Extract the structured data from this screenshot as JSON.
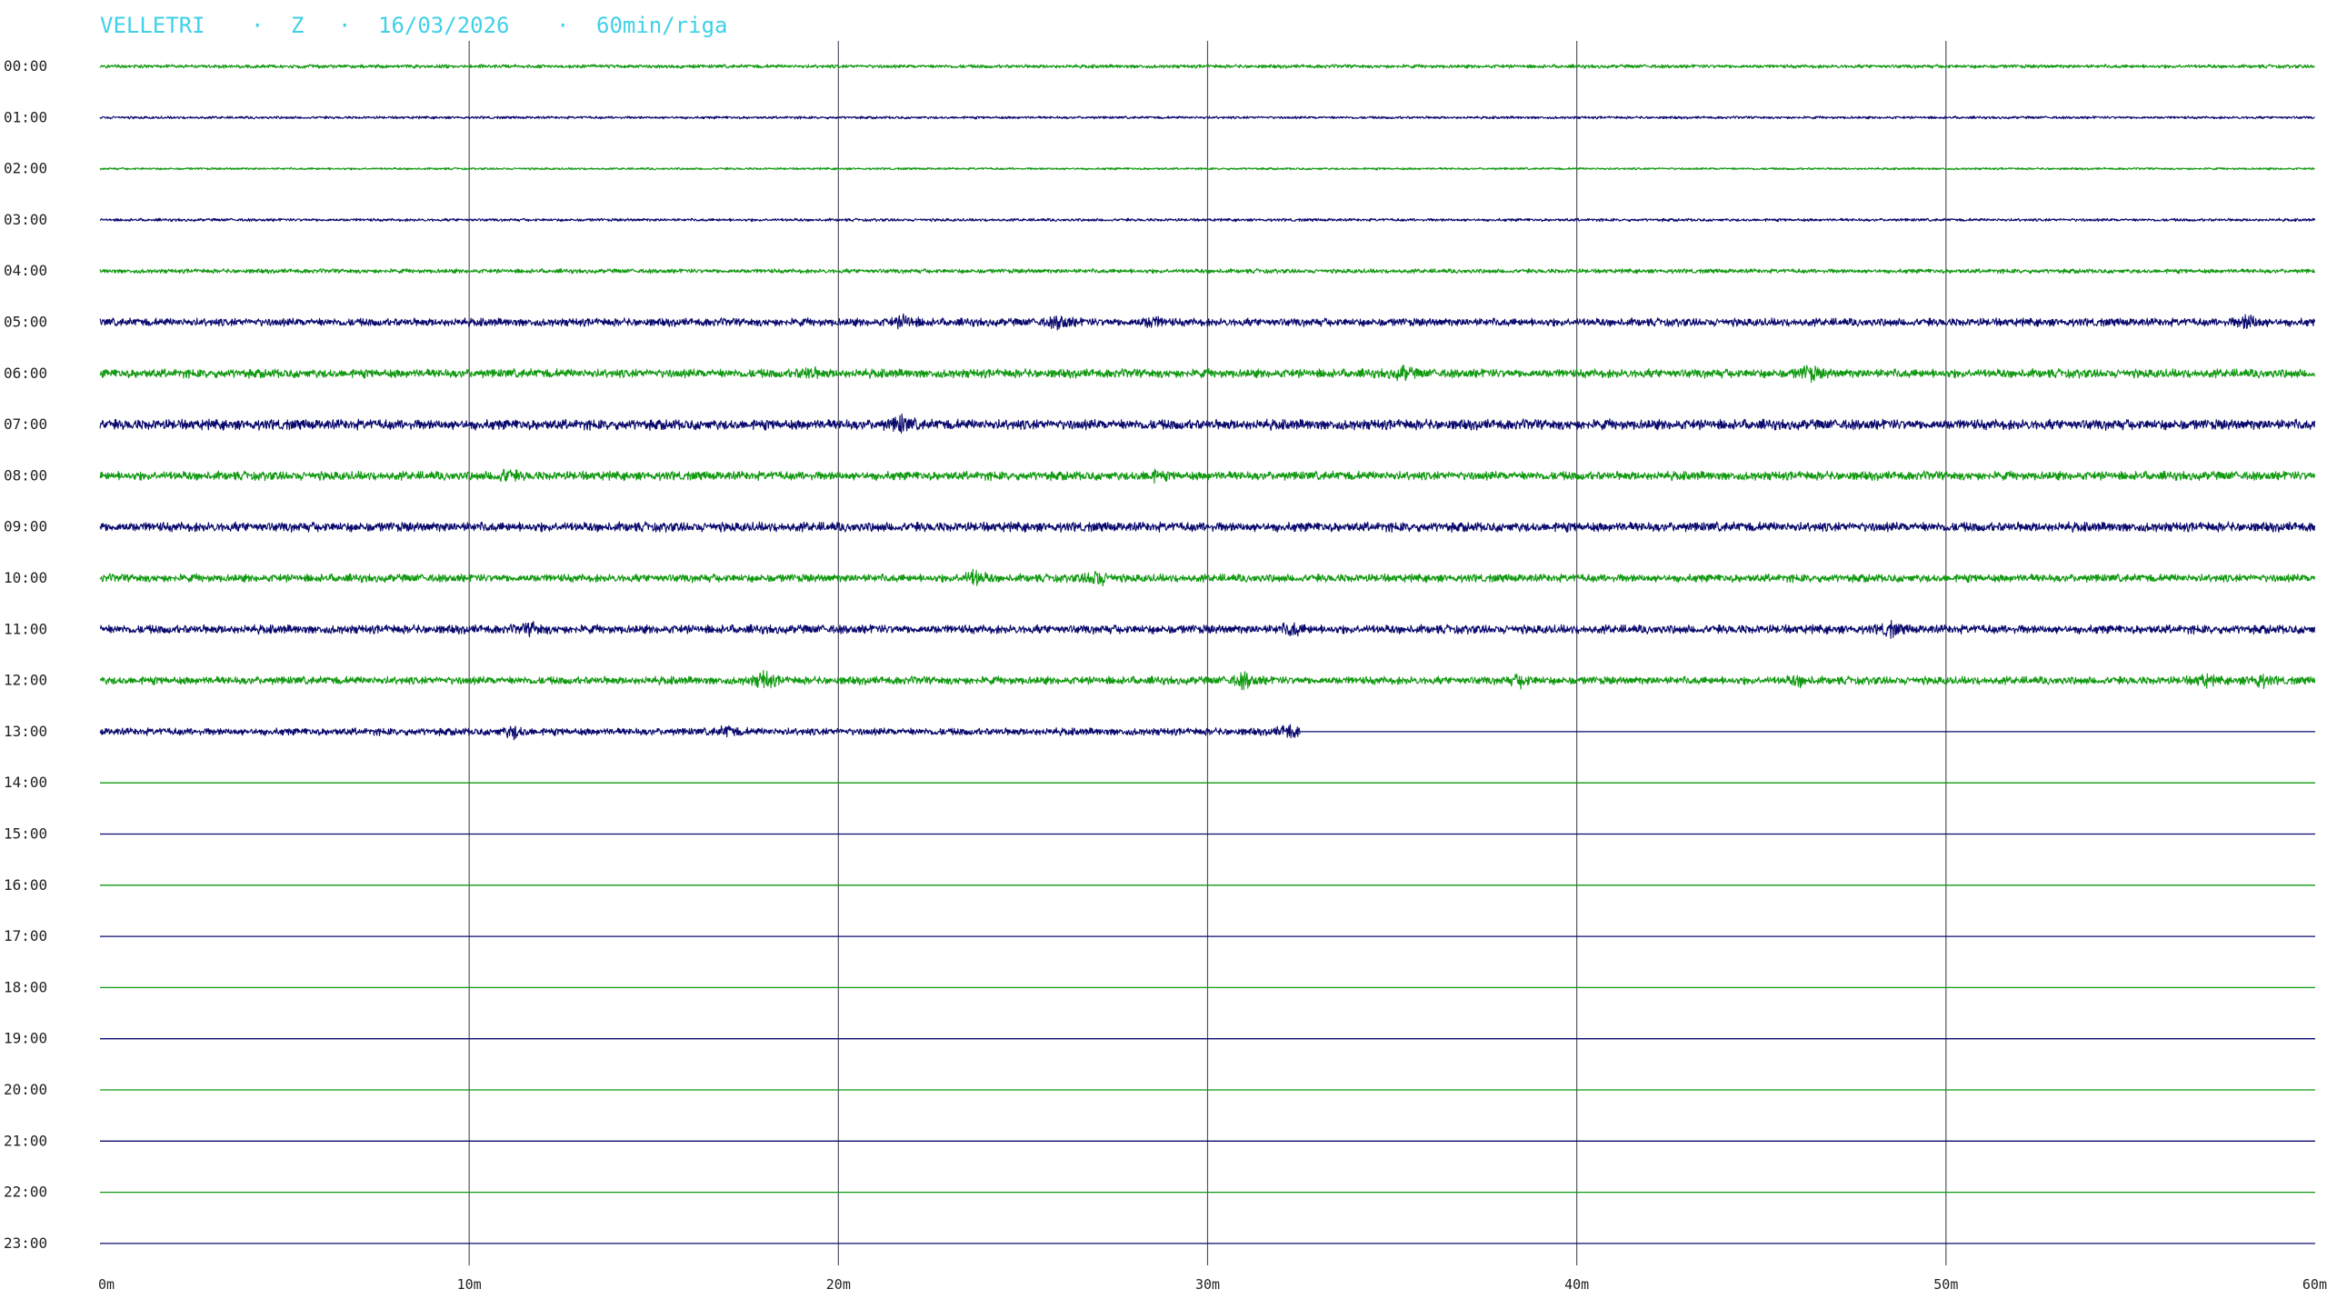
{
  "header": {
    "station": "VELLETRI",
    "component": "Z",
    "date": "16/03/2026",
    "scale": "60min/riga",
    "separator": "·"
  },
  "chart_data": {
    "type": "helicorder",
    "rows": [
      "00:00",
      "01:00",
      "02:00",
      "03:00",
      "04:00",
      "05:00",
      "06:00",
      "07:00",
      "08:00",
      "09:00",
      "10:00",
      "11:00",
      "12:00",
      "13:00",
      "14:00",
      "15:00",
      "16:00",
      "17:00",
      "18:00",
      "19:00",
      "20:00",
      "21:00",
      "22:00",
      "23:00"
    ],
    "x_ticks": [
      "0m",
      "10m",
      "20m",
      "30m",
      "40m",
      "50m",
      "60m"
    ],
    "x_tick_values": [
      0,
      10,
      20,
      30,
      40,
      50,
      60
    ],
    "xlim": [
      0,
      60
    ],
    "data_end_minute": 32.5,
    "data_end_row": 13,
    "row_colors": [
      "#119911",
      "#0a0a6e"
    ],
    "grid_color": "#555566",
    "noise_level": [
      0.25,
      0.18,
      0.15,
      0.2,
      0.3,
      0.55,
      0.6,
      0.7,
      0.6,
      0.65,
      0.55,
      0.6,
      0.55,
      0.5
    ],
    "events": [
      {
        "row": 5,
        "minute": 21.8,
        "amplitude": 0.9
      },
      {
        "row": 5,
        "minute": 26.0,
        "amplitude": 0.9
      },
      {
        "row": 5,
        "minute": 28.5,
        "amplitude": 0.7
      },
      {
        "row": 5,
        "minute": 58.2,
        "amplitude": 1.1
      },
      {
        "row": 6,
        "minute": 19.2,
        "amplitude": 0.7
      },
      {
        "row": 6,
        "minute": 35.3,
        "amplitude": 0.8
      },
      {
        "row": 6,
        "minute": 46.3,
        "amplitude": 1.0
      },
      {
        "row": 7,
        "minute": 21.7,
        "amplitude": 1.0
      },
      {
        "row": 8,
        "minute": 11.0,
        "amplitude": 0.8
      },
      {
        "row": 8,
        "minute": 28.5,
        "amplitude": 0.6
      },
      {
        "row": 10,
        "minute": 23.7,
        "amplitude": 1.1
      },
      {
        "row": 10,
        "minute": 27.0,
        "amplitude": 1.1
      },
      {
        "row": 11,
        "minute": 11.7,
        "amplitude": 0.7
      },
      {
        "row": 11,
        "minute": 32.3,
        "amplitude": 0.8
      },
      {
        "row": 11,
        "minute": 48.5,
        "amplitude": 0.8
      },
      {
        "row": 12,
        "minute": 18.0,
        "amplitude": 1.2
      },
      {
        "row": 12,
        "minute": 31.0,
        "amplitude": 1.0
      },
      {
        "row": 12,
        "minute": 38.5,
        "amplitude": 0.7
      },
      {
        "row": 12,
        "minute": 46.0,
        "amplitude": 0.6
      },
      {
        "row": 12,
        "minute": 57.0,
        "amplitude": 0.7
      },
      {
        "row": 12,
        "minute": 58.5,
        "amplitude": 0.8
      },
      {
        "row": 13,
        "minute": 11.2,
        "amplitude": 0.8
      },
      {
        "row": 13,
        "minute": 17.0,
        "amplitude": 0.6
      },
      {
        "row": 13,
        "minute": 32.2,
        "amplitude": 0.9
      }
    ]
  }
}
